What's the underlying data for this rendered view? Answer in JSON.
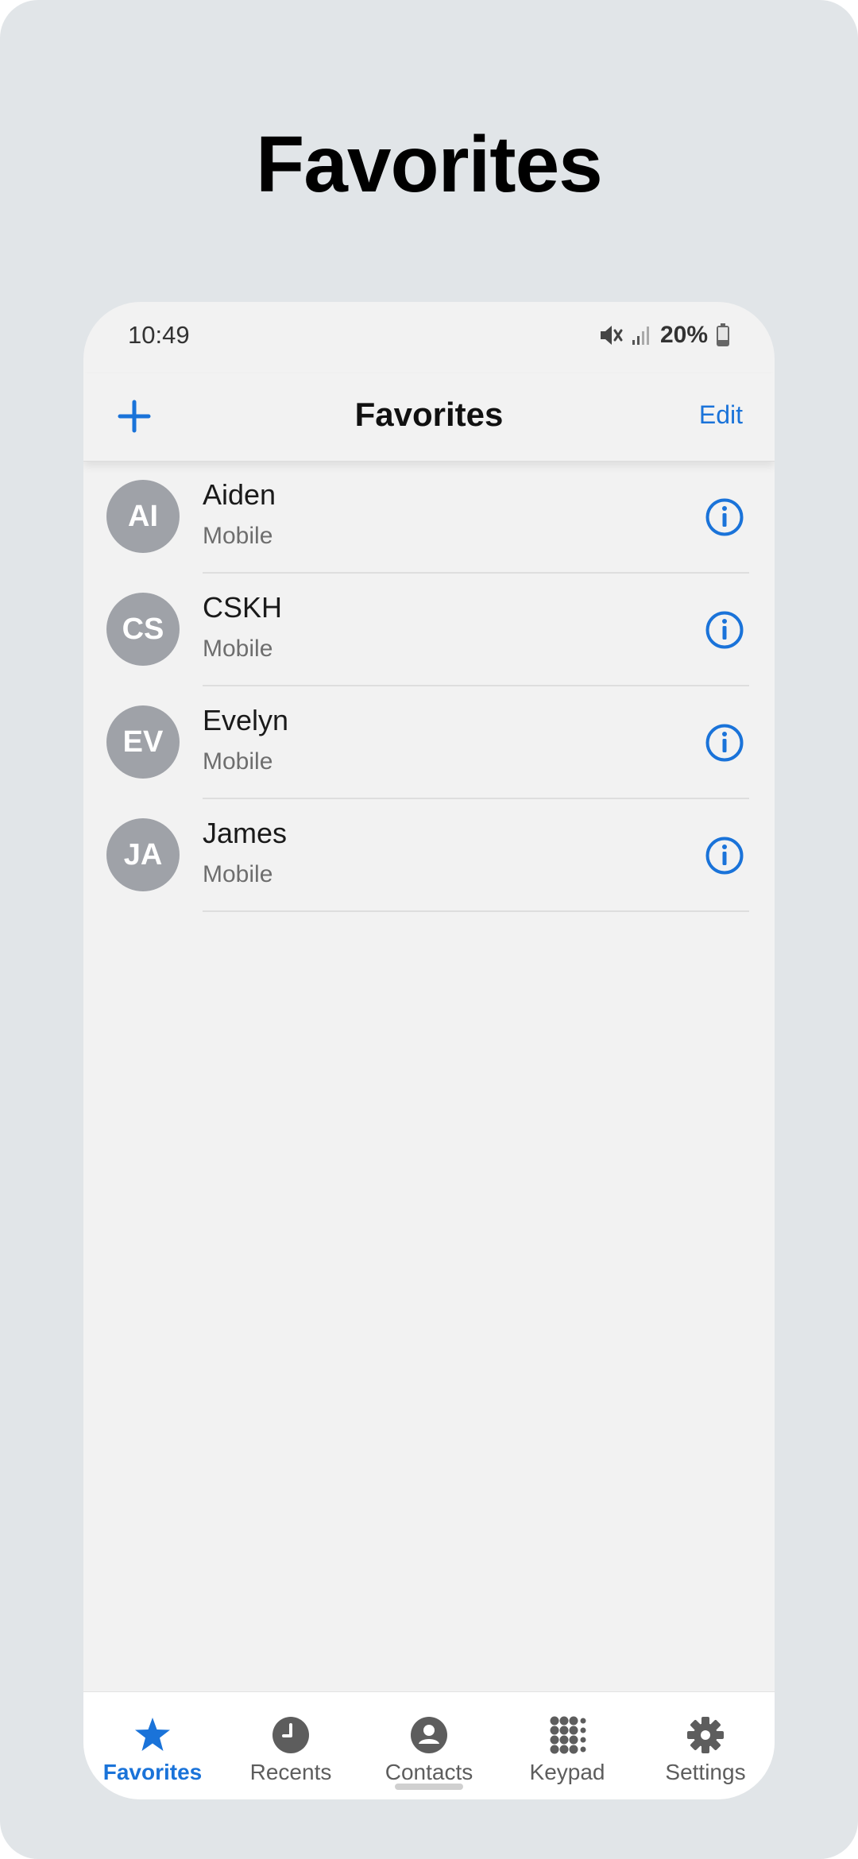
{
  "page": {
    "heading": "Favorites"
  },
  "status_bar": {
    "time": "10:49",
    "battery": "20%"
  },
  "header": {
    "title": "Favorites",
    "edit_label": "Edit",
    "add_icon": "plus-icon"
  },
  "favorites": [
    {
      "initials": "AI",
      "name": "Aiden",
      "type": "Mobile"
    },
    {
      "initials": "CS",
      "name": "CSKH",
      "type": "Mobile"
    },
    {
      "initials": "EV",
      "name": "Evelyn",
      "type": "Mobile"
    },
    {
      "initials": "JA",
      "name": "James",
      "type": "Mobile"
    }
  ],
  "tabs": [
    {
      "label": "Favorites",
      "icon": "star-icon",
      "active": true
    },
    {
      "label": "Recents",
      "icon": "clock-icon",
      "active": false
    },
    {
      "label": "Contacts",
      "icon": "person-icon",
      "active": false
    },
    {
      "label": "Keypad",
      "icon": "keypad-icon",
      "active": false
    },
    {
      "label": "Settings",
      "icon": "gear-icon",
      "active": false
    }
  ],
  "colors": {
    "accent": "#1a73d9",
    "avatar_bg": "#9fa2a8",
    "background": "#e1e5e8",
    "screen_bg": "#f2f2f2"
  }
}
